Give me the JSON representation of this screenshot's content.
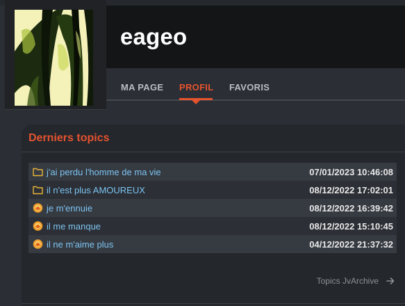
{
  "profile": {
    "username": "eageo"
  },
  "nav": {
    "tabs": [
      {
        "label": "MA PAGE",
        "active": false
      },
      {
        "label": "PROFIL",
        "active": true
      },
      {
        "label": "FAVORIS",
        "active": false
      }
    ]
  },
  "panel": {
    "title": "Derniers topics",
    "topics": [
      {
        "icon": "folder-icon",
        "title": "j'ai perdu l'homme de ma vie",
        "date": "07/01/2023 10:46:08"
      },
      {
        "icon": "folder-icon",
        "title": "il n'est plus AMOUREUX",
        "date": "08/12/2022 17:02:01"
      },
      {
        "icon": "hot-topic-icon",
        "title": "je m'ennuie",
        "date": "08/12/2022 16:39:42"
      },
      {
        "icon": "hot-topic-icon",
        "title": "il me manque",
        "date": "08/12/2022 15:10:45"
      },
      {
        "icon": "hot-topic-icon",
        "title": "il ne m'aime plus",
        "date": "04/12/2022 21:37:32"
      }
    ],
    "footer_link": "Topics JvArchive"
  },
  "colors": {
    "accent": "#e4532f",
    "link": "#7cc4f2",
    "folder": "#e8b53a"
  }
}
